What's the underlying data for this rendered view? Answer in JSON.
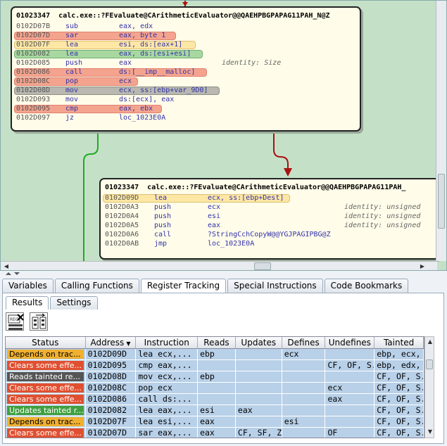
{
  "graph": {
    "node1": {
      "address": "01023347",
      "function": "calc.exe::?FEvaluate@CArithmeticEvaluator@@QAEHPBGPAPAG11PAH_N@Z",
      "rows": [
        {
          "addr": "0102D07B",
          "mn": "sub",
          "op": "eax, edx",
          "hl": "",
          "w": 0
        },
        {
          "addr": "0102D07D",
          "mn": "sar",
          "op": "eax, byte 1",
          "hl": "red",
          "w": 230
        },
        {
          "addr": "0102D07F",
          "mn": "lea",
          "op": "esi, ds:[eax+1]",
          "hl": "yellow",
          "w": 258
        },
        {
          "addr": "0102D082",
          "mn": "lea",
          "op": "eax, ds:[esi+esi]",
          "hl": "green",
          "w": 268
        },
        {
          "addr": "0102D085",
          "mn": "push",
          "op": "eax",
          "hl": "",
          "w": 0,
          "comment": "identity: Size"
        },
        {
          "addr": "0102D086",
          "mn": "call",
          "op": "ds:[__imp__malloc]",
          "hl": "red",
          "w": 274
        },
        {
          "addr": "0102D08C",
          "mn": "pop",
          "op": "ecx",
          "hl": "red",
          "w": 176
        },
        {
          "addr": "0102D08D",
          "mn": "mov",
          "op": "ecx, ss:[ebp+var_9D0]",
          "hl": "gray",
          "w": 292
        },
        {
          "addr": "0102D093",
          "mn": "mov",
          "op": "ds:[ecx], eax",
          "hl": "",
          "w": 0
        },
        {
          "addr": "0102D095",
          "mn": "cmp",
          "op": "eax, ebx",
          "hl": "red",
          "w": 210
        },
        {
          "addr": "0102D097",
          "mn": "jz",
          "op": "loc_1023E0A",
          "hl": "",
          "w": 0
        }
      ]
    },
    "node2": {
      "address": "01023347",
      "function": "calc.exe::?FEvaluate@CArithmeticEvaluator@@QAEHPBGPAPAG11PAH_",
      "rows": [
        {
          "addr": "0102D09D",
          "mn": "lea",
          "op": "ecx, ss:[ebp+Dest]",
          "hl": "yellow",
          "w": 266
        },
        {
          "addr": "0102D0A3",
          "mn": "push",
          "op": "ecx",
          "hl": "",
          "w": 0,
          "comment": "identity: unsigned"
        },
        {
          "addr": "0102D0A4",
          "mn": "push",
          "op": "esi",
          "hl": "",
          "w": 0,
          "comment": "identity: unsigned"
        },
        {
          "addr": "0102D0A5",
          "mn": "push",
          "op": "eax",
          "hl": "",
          "w": 0,
          "comment": "identity: unsigned"
        },
        {
          "addr": "0102D0A6",
          "mn": "call",
          "op": "?StringCchCopyW@@YGJPAGIPBG@Z",
          "hl": "",
          "w": 0
        },
        {
          "addr": "0102D0AB",
          "mn": "jmp",
          "op": "loc_1023E0A",
          "hl": "",
          "w": 0
        }
      ]
    }
  },
  "main_tabs": [
    "Variables",
    "Calling Functions",
    "Register Tracking",
    "Special Instructions",
    "Code Bookmarks"
  ],
  "main_tab_active": 2,
  "sub_tabs": [
    "Results",
    "Settings"
  ],
  "sub_tab_active": 0,
  "toolbar_icons": [
    "register-clear-icon",
    "register-tracking-icon"
  ],
  "table": {
    "columns": [
      "Status",
      "Address",
      "Instruction",
      "Reads",
      "Updates",
      "Defines",
      "Undefines",
      "Tainted"
    ],
    "sort_indicator": "▼",
    "rows": [
      {
        "status": "Depends on trac...",
        "color": "#f0b030",
        "text_color": "#000",
        "address": "0102D09D",
        "instruction": "lea ecx,...",
        "reads": "ebp",
        "updates": "",
        "defines": "ecx",
        "undefines": "",
        "tainted": "ebp, ecx, e..."
      },
      {
        "status": "Clears some effe...",
        "color": "#e05030",
        "text_color": "#fff",
        "address": "0102D095",
        "instruction": "cmp eax,...",
        "reads": "",
        "updates": "",
        "defines": "",
        "undefines": "CF, OF, S...",
        "tainted": "ebp, edx, ..."
      },
      {
        "status": "Reads tainted re...",
        "color": "#555555",
        "text_color": "#fff",
        "address": "0102D08D",
        "instruction": "mov ecx,...",
        "reads": "ebp",
        "updates": "",
        "defines": "",
        "undefines": "",
        "tainted": "CF, OF, S..."
      },
      {
        "status": "Clears some effe...",
        "color": "#e05030",
        "text_color": "#fff",
        "address": "0102D08C",
        "instruction": "pop ecx",
        "reads": "",
        "updates": "",
        "defines": "",
        "undefines": "ecx",
        "tainted": "CF, OF, S..."
      },
      {
        "status": "Clears some effe...",
        "color": "#e05030",
        "text_color": "#fff",
        "address": "0102D086",
        "instruction": "call ds:...",
        "reads": "",
        "updates": "",
        "defines": "",
        "undefines": "eax",
        "tainted": "CF, OF, S..."
      },
      {
        "status": "Updates tainted r...",
        "color": "#40a040",
        "text_color": "#fff",
        "address": "0102D082",
        "instruction": "lea eax,...",
        "reads": "esi",
        "updates": "eax",
        "defines": "",
        "undefines": "",
        "tainted": "CF, OF, S..."
      },
      {
        "status": "Depends on trac...",
        "color": "#f0b030",
        "text_color": "#000",
        "address": "0102D07F",
        "instruction": "lea esi,...",
        "reads": "eax",
        "updates": "",
        "defines": "esi",
        "undefines": "",
        "tainted": "CF, OF, S..."
      },
      {
        "status": "Clears some effe...",
        "color": "#e05030",
        "text_color": "#fff",
        "address": "0102D07D",
        "instruction": "sar eax,...",
        "reads": "eax",
        "updates": "CF, SF, Z...",
        "defines": "",
        "undefines": "OF",
        "tainted": "CF, OF, S..."
      }
    ]
  },
  "colors": {
    "graph_bg": "#c4e1c8",
    "edge_red": "#aa1111",
    "edge_green": "#22aa22",
    "row_bg": "#b8d0e8"
  }
}
